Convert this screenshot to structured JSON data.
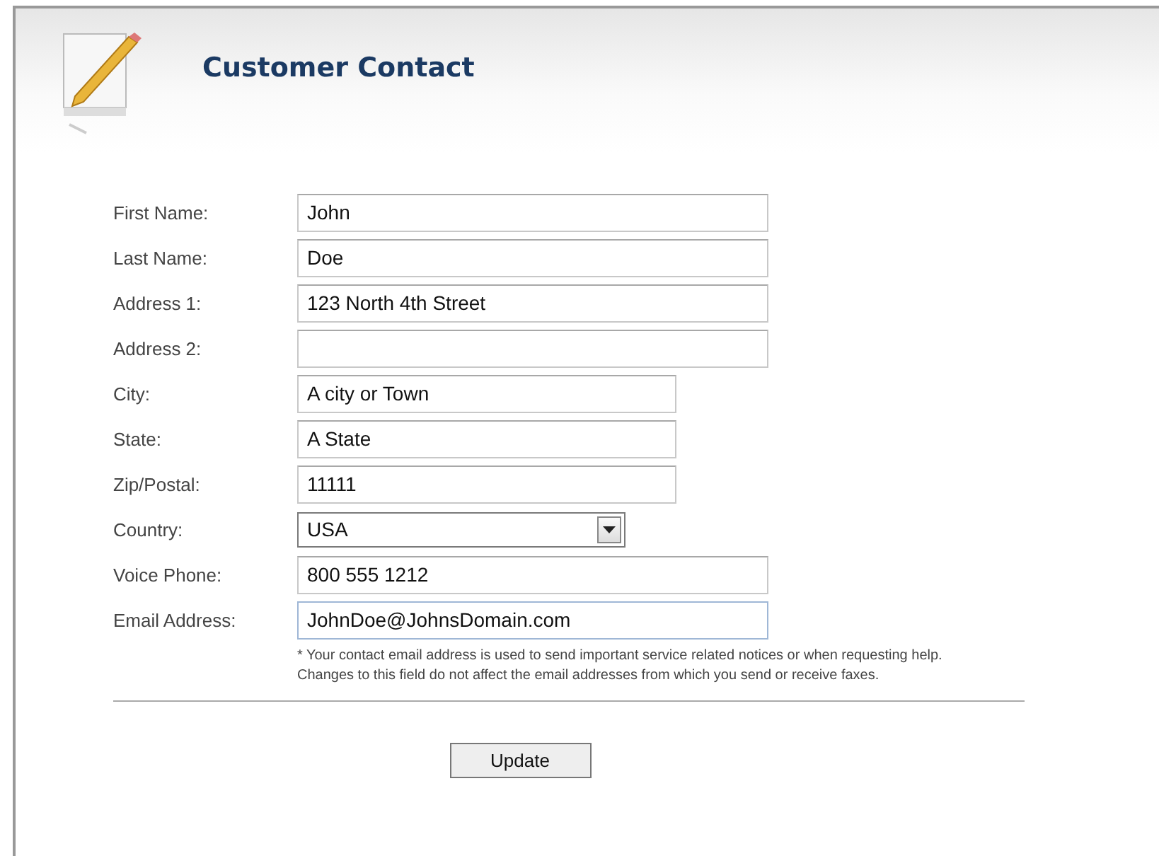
{
  "header": {
    "title": "Customer Contact"
  },
  "fields": [
    {
      "label": "First Name:",
      "kind": "text",
      "value": "John",
      "focused": false
    },
    {
      "label": "Last Name:",
      "kind": "text",
      "value": "Doe",
      "focused": false
    },
    {
      "label": "Address 1:",
      "kind": "text",
      "value": "123 North 4th Street",
      "focused": false
    },
    {
      "label": "Address 2:",
      "kind": "text",
      "focused": false
    },
    {
      "label": "City:",
      "kind": "text",
      "value": "A city or Town",
      "focused": false
    },
    {
      "label": "State:",
      "kind": "text",
      "value": "A State",
      "focused": false
    },
    {
      "label": "Zip/Postal:",
      "kind": "text",
      "value": "11111",
      "focused": false
    },
    {
      "label": "Country:",
      "kind": "select",
      "value": "USA",
      "focused": false
    },
    {
      "label": "Voice Phone:",
      "kind": "text",
      "value": "800 555 1212",
      "focused": false
    },
    {
      "label": "Email Address:",
      "kind": "text",
      "value": "JohnDoe@JohnsDomain.com",
      "focused": true
    }
  ],
  "note": "* Your contact email address is used to send important service related notices or when requesting help. Changes to this field do not affect the email addresses from which you send or receive faxes.",
  "buttons": [
    "Update"
  ]
}
